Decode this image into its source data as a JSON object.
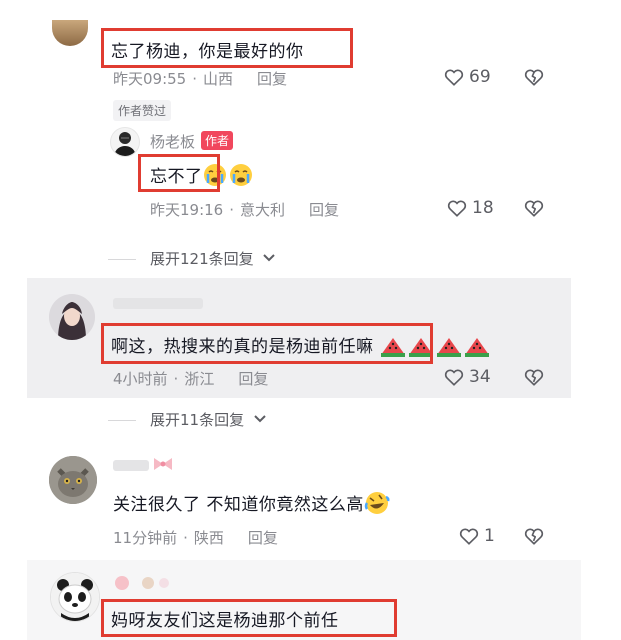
{
  "comments": [
    {
      "text": "忘了杨迪，你是最好的你",
      "time": "昨天09:55",
      "location": "山西",
      "reply": "回复",
      "likes": "69",
      "liked_tag": "作者赞过"
    },
    {
      "author": "杨老板",
      "author_badge": "作者",
      "text": "忘不了",
      "time": "昨天19:16",
      "location": "意大利",
      "reply": "回复",
      "likes": "18"
    },
    {
      "expand": "展开121条回复"
    },
    {
      "text": "啊这，热搜来的真的是杨迪前任嘛",
      "time": "4小时前",
      "location": "浙江",
      "reply": "回复",
      "likes": "34",
      "expand": "展开11条回复"
    },
    {
      "text": "关注很久了 不知道你竟然这么高",
      "time": "11分钟前",
      "location": "陕西",
      "reply": "回复",
      "likes": "1"
    },
    {
      "text": "妈呀友友们这是杨迪那个前任"
    }
  ],
  "colors": {
    "highlight": "#e03c31",
    "badge": "#f1475d",
    "meta_text": "#8a8b91",
    "highlighted_row_bg": "#efeff1"
  },
  "icons": [
    "heart-outline-icon",
    "broken-heart-icon",
    "chevron-down-icon",
    "crying-emoji-icon",
    "watermelon-emoji-icon",
    "rofl-emoji-icon"
  ]
}
